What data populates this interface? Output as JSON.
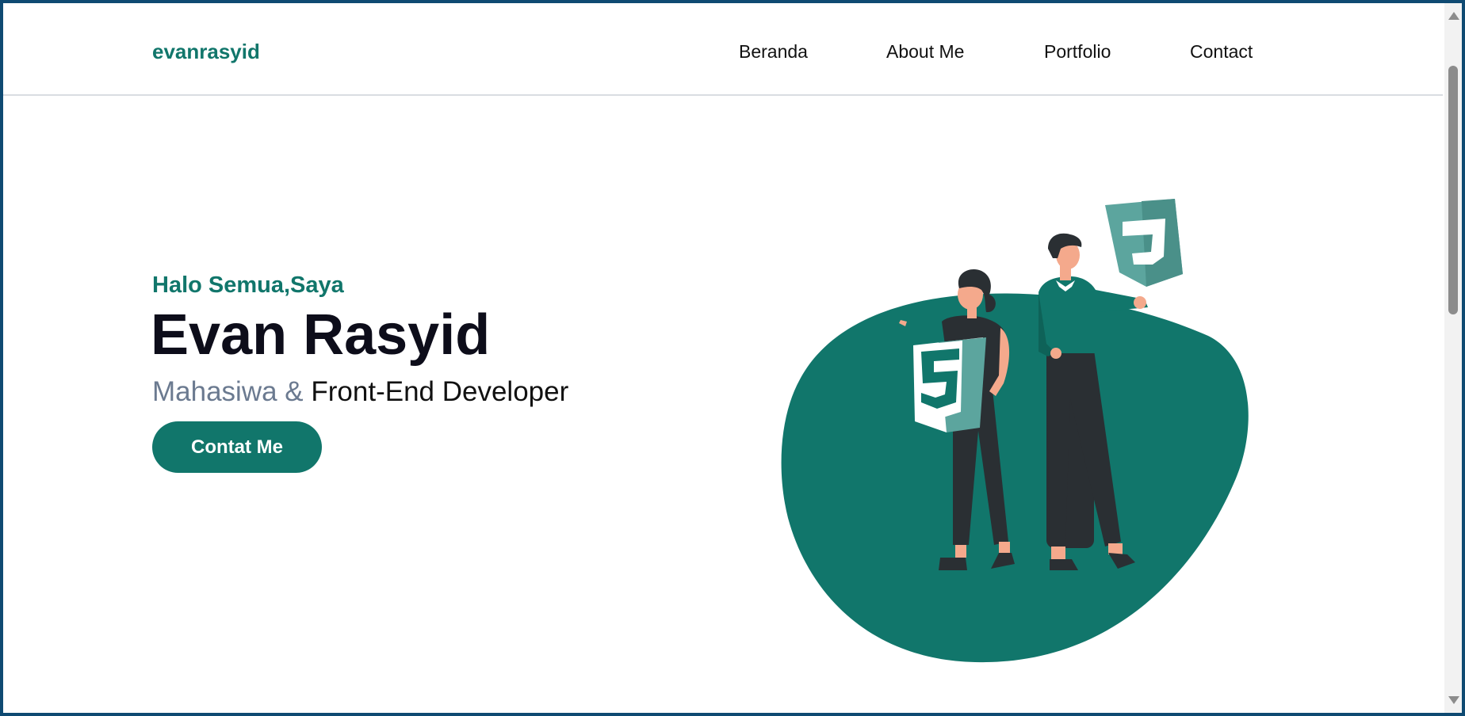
{
  "navbar": {
    "logo": "evanrasyid",
    "links": [
      "Beranda",
      "About Me",
      "Portfolio",
      "Contact"
    ]
  },
  "hero": {
    "greeting": "Halo Semua,Saya",
    "name": "Evan Rasyid",
    "role_muted": "Mahasiwa & ",
    "role_dark": "Front-End Developer",
    "cta_label": "Contat Me"
  },
  "illustration": {
    "html_badge_glyph": "5",
    "js_badge_glyph": "J"
  },
  "colors": {
    "brand": "#11766b",
    "badge": "#5ca59e",
    "dark": "#2a2f33",
    "skin": "#f4a98c"
  }
}
